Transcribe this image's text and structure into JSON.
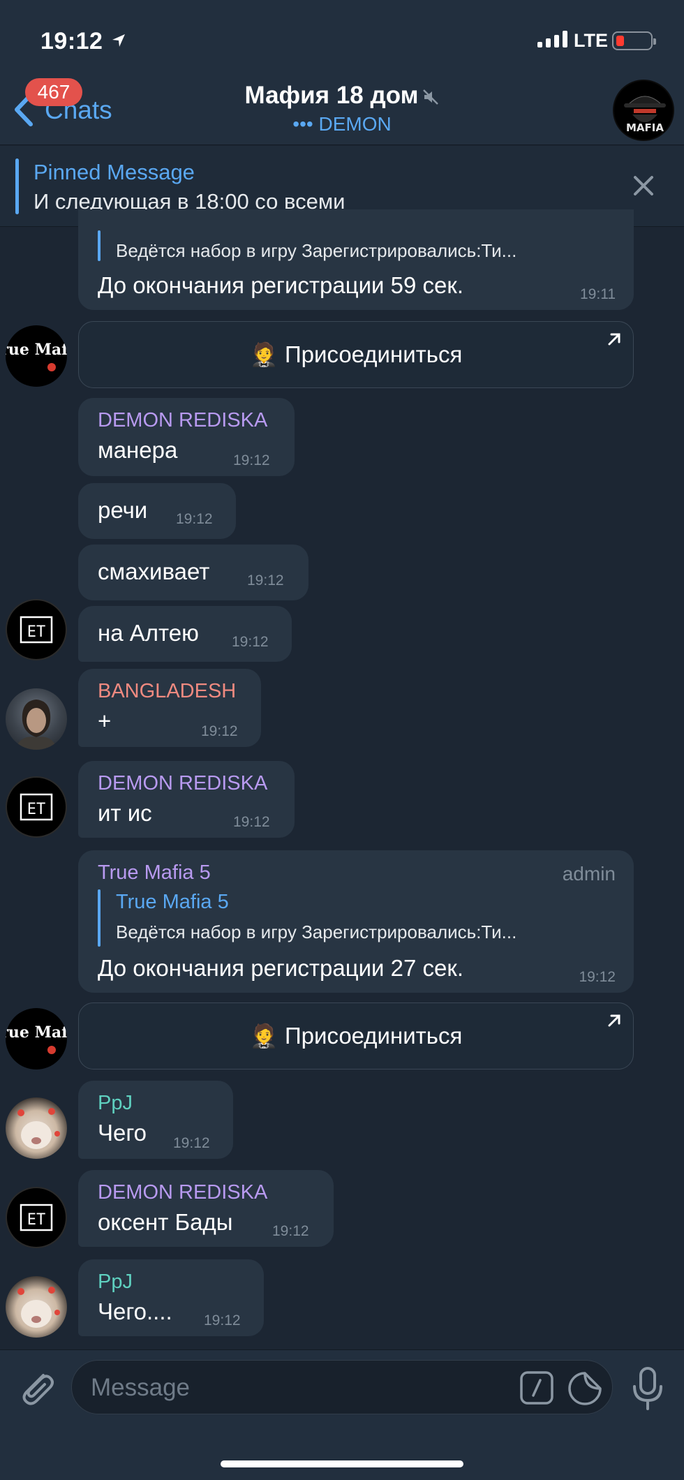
{
  "status_bar": {
    "time": "19:12",
    "network": "LTE"
  },
  "header": {
    "back_label": "Chats",
    "unread_badge": "467",
    "title": "Мафия 18 дом",
    "subtitle": "••• DEMON"
  },
  "pinned": {
    "title": "Pinned Message",
    "text": "И следующая в 18:00 со всеми"
  },
  "join_button_label": "Присоединиться",
  "messages": [
    {
      "reply_text": "Ведётся набор в игру Зарегистрировались:Ти...",
      "text": "До окончания регистрации 59 сек.",
      "time": "19:11"
    },
    {
      "sender": "DEMON REDISKA",
      "text": "манера",
      "time": "19:12"
    },
    {
      "text": "речи",
      "time": "19:12"
    },
    {
      "text": "смахивает",
      "time": "19:12"
    },
    {
      "text": "на Алтею",
      "time": "19:12"
    },
    {
      "sender": "BANGLADESH",
      "text": "+",
      "time": "19:12"
    },
    {
      "sender": "DEMON REDISKA",
      "text": "ит ис",
      "time": "19:12"
    },
    {
      "sender": "True Mafia 5",
      "badge": "admin",
      "reply_title": "True Mafia 5",
      "reply_text": "Ведётся набор в игру Зарегистрировались:Ти...",
      "text": "До окончания регистрации 27 сек.",
      "time": "19:12"
    },
    {
      "sender": "PpJ",
      "text": "Чего",
      "time": "19:12"
    },
    {
      "sender": "DEMON REDISKA",
      "text": "оксент Бады",
      "time": "19:12"
    },
    {
      "sender": "PpJ",
      "text": "Чего....",
      "time": "19:12"
    }
  ],
  "input": {
    "placeholder": "Message"
  },
  "avatars": {
    "true_mafia": "True Mafia",
    "et": "ET",
    "header_logo": "MAFIA"
  },
  "colors": {
    "background": "#1c2633",
    "bubble": "#283543",
    "accent": "#5aa8f2",
    "sender_demon": "#b89af0",
    "sender_bangladesh": "#f08a80",
    "sender_ppj": "#5fd1c0",
    "badge": "#e3524c"
  },
  "icons": [
    "location-arrow-icon",
    "signal-icon",
    "battery-icon",
    "back-chevron-icon",
    "mute-icon",
    "close-icon",
    "external-link-icon",
    "butler-emoji-icon",
    "attach-icon",
    "bot-command-icon",
    "sticker-icon",
    "microphone-icon"
  ]
}
